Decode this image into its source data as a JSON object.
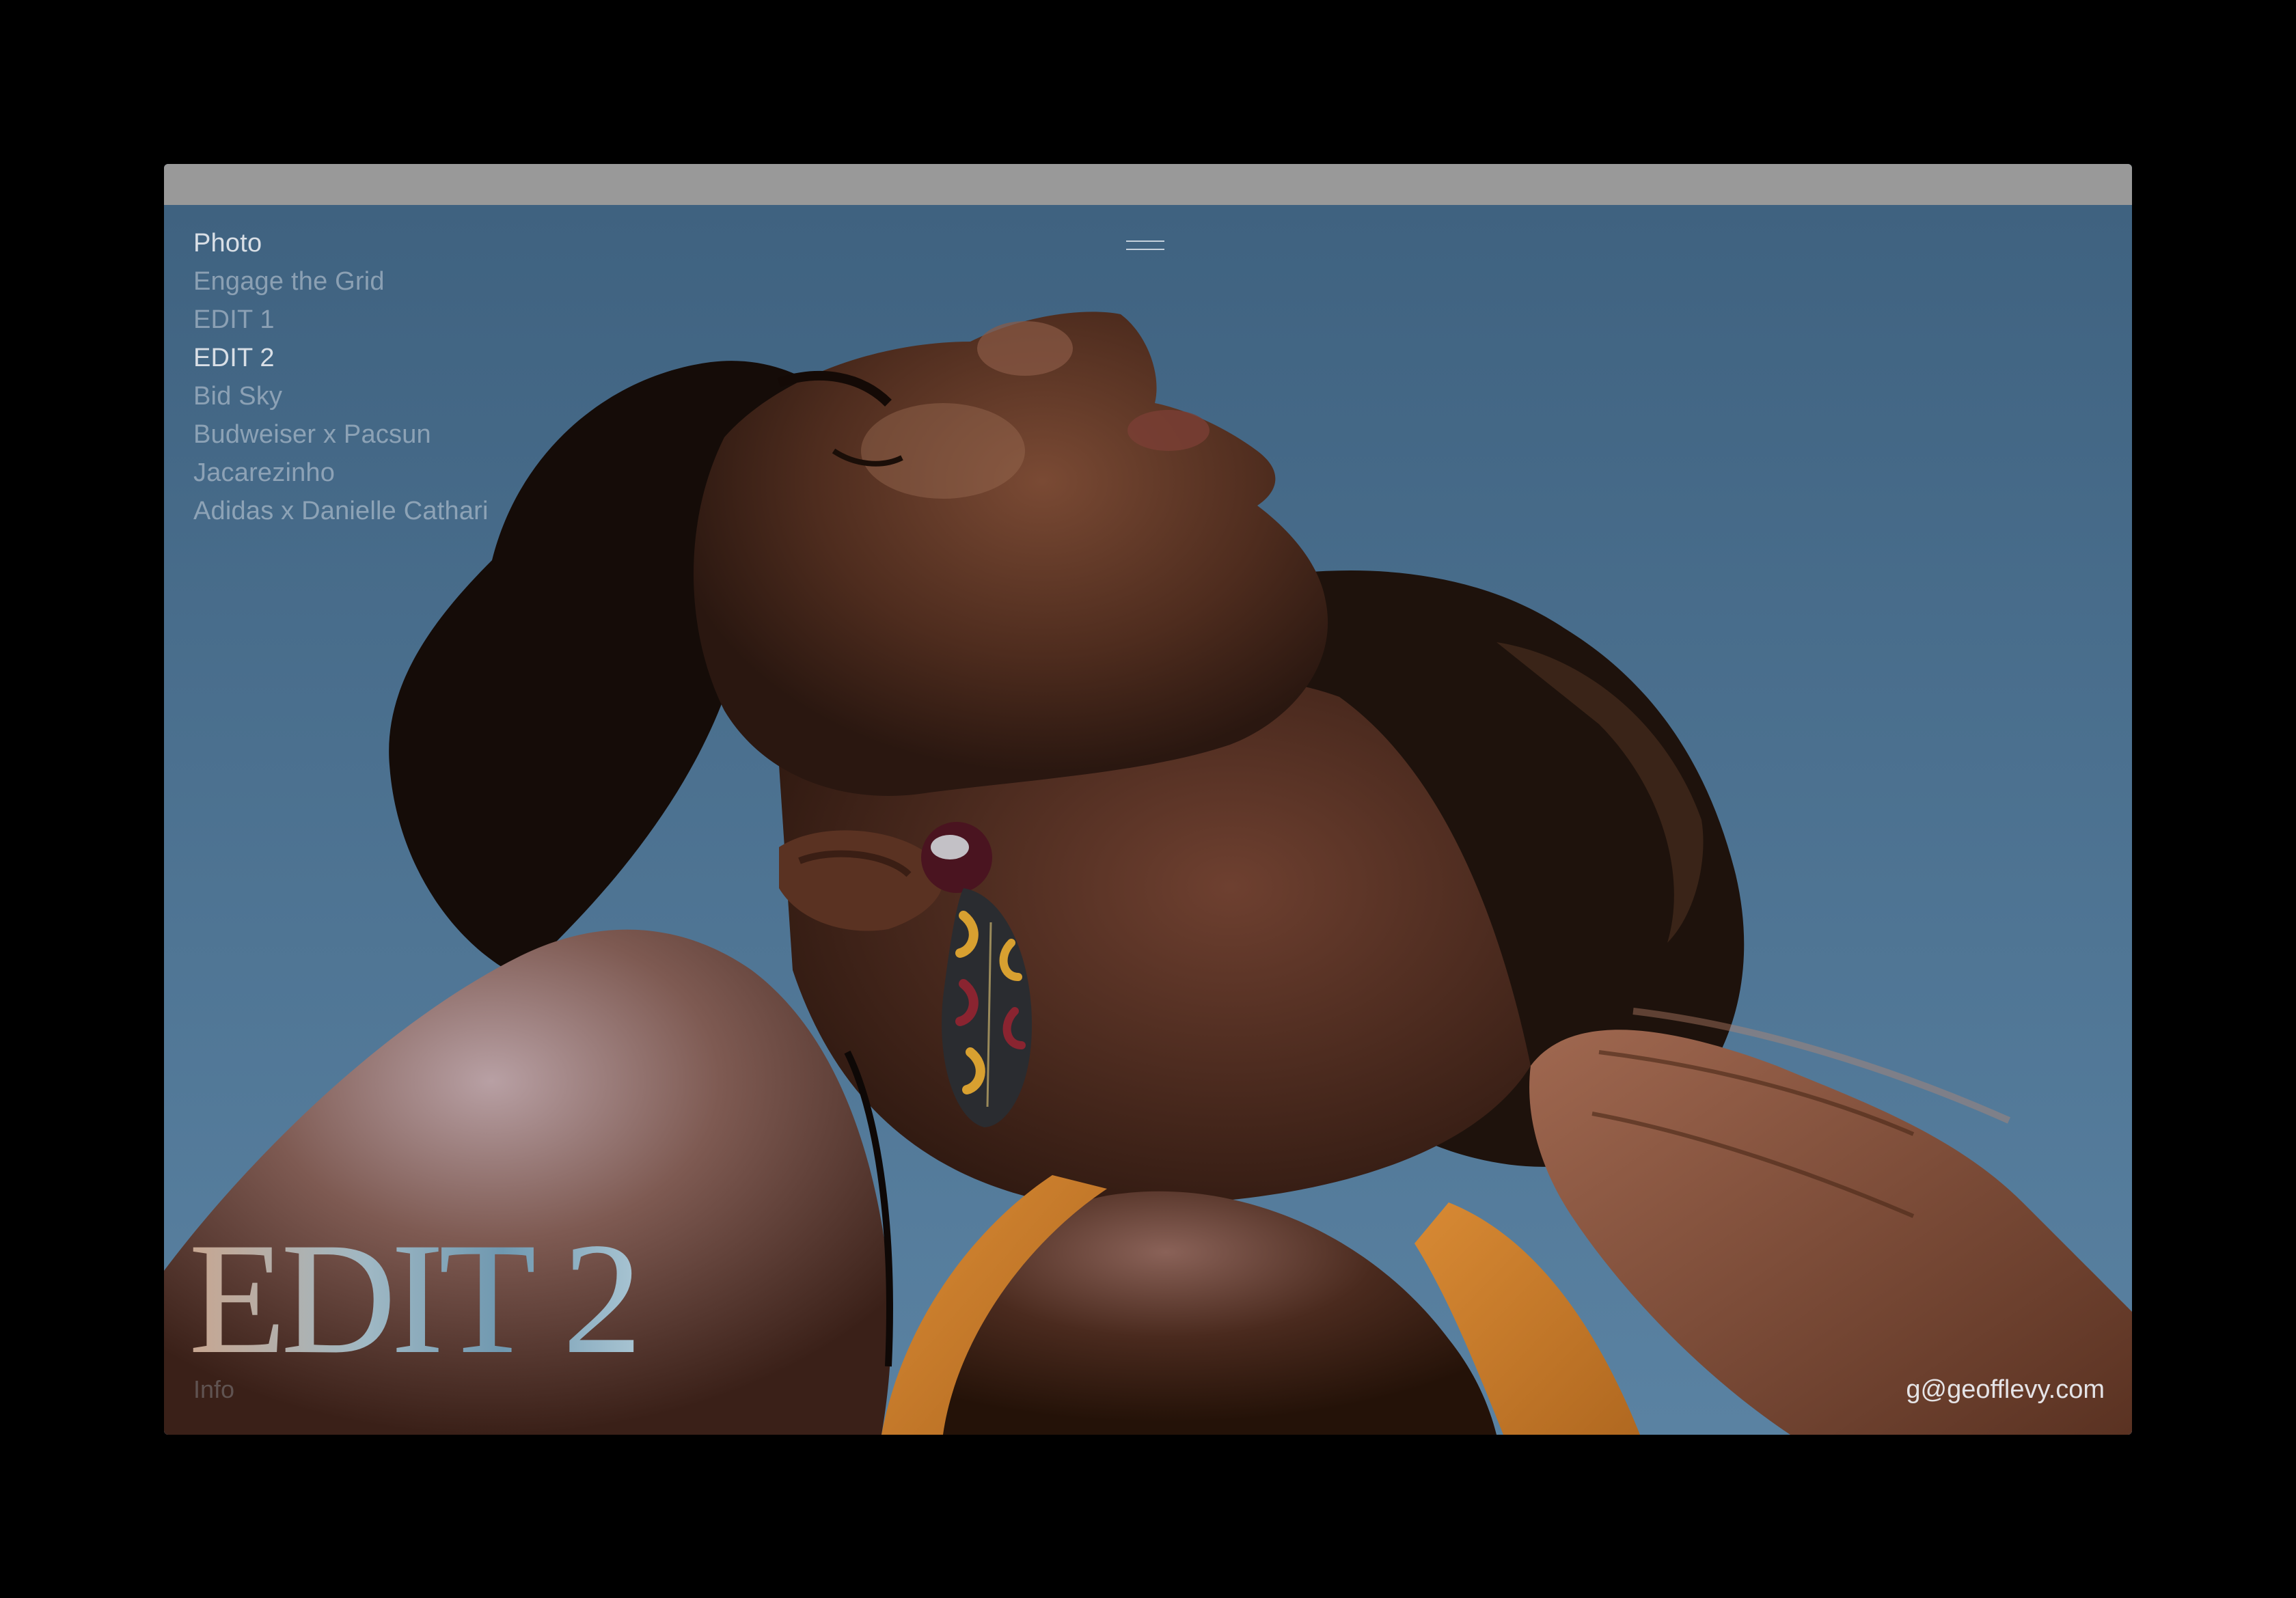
{
  "nav": {
    "items": [
      {
        "label": "Photo",
        "active": true
      },
      {
        "label": "Engage the Grid",
        "active": false
      },
      {
        "label": "EDIT 1",
        "active": false
      },
      {
        "label": "EDIT 2",
        "active": true
      },
      {
        "label": "Bid Sky",
        "active": false
      },
      {
        "label": "Budweiser x Pacsun",
        "active": false
      },
      {
        "label": "Jacarezinho",
        "active": false
      },
      {
        "label": "Adidas x Danielle Cathari",
        "active": false
      }
    ]
  },
  "menu": {
    "icon": "hamburger-icon"
  },
  "project": {
    "title": "EDIT 2",
    "info_label": "Info"
  },
  "contact": {
    "email": "g@geofflevy.com"
  },
  "colors": {
    "sky": "#4a6e8e",
    "skin": "#5a3424",
    "top": "#c8782a",
    "window_bar": "#999999",
    "background": "#000000"
  }
}
